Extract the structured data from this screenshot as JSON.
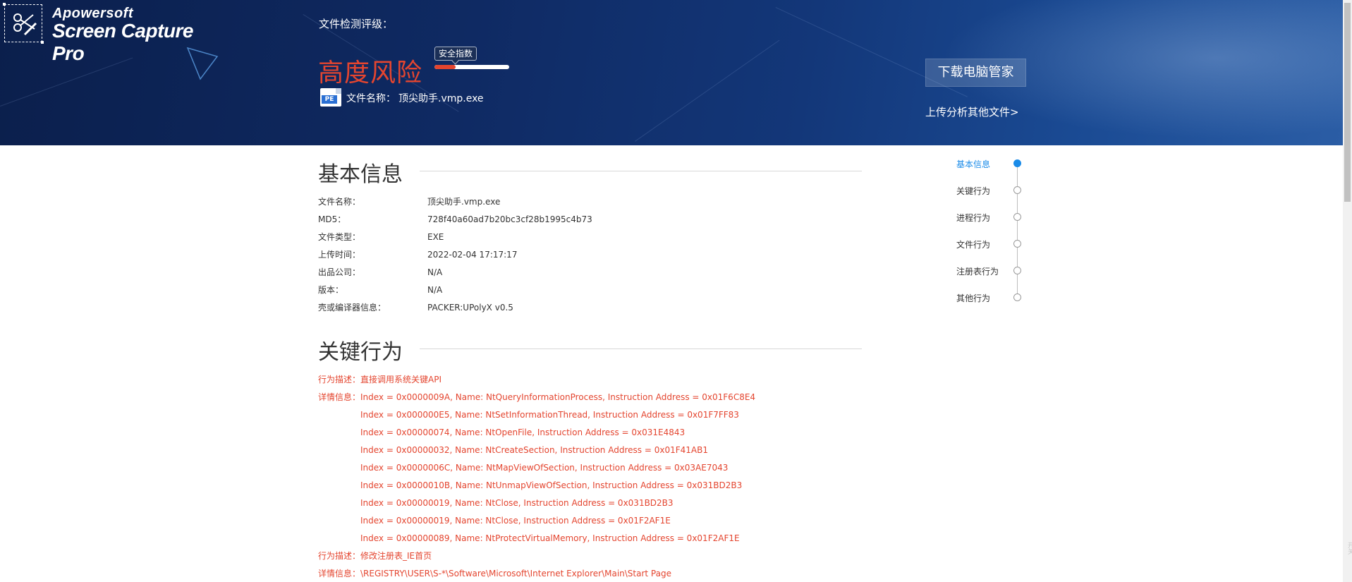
{
  "logo": {
    "brand": "Apowersoft",
    "product": "Screen Capture Pro"
  },
  "header": {
    "rating_label": "文件检测评级：",
    "risk_level": "高度风险",
    "safety_tip": "安全指数",
    "safety_score_fraction": 0.28,
    "file_label": "文件名称：",
    "file_name": "顶尖助手.vmp.exe",
    "file_icon_text": "PE",
    "download_button": "下载电脑管家",
    "upload_link": "上传分析其他文件>"
  },
  "basic_info": {
    "title": "基本信息",
    "rows": [
      {
        "label": "文件名称：",
        "value": "顶尖助手.vmp.exe"
      },
      {
        "label": "MD5：",
        "value": "728f40a60ad7b20bc3cf28b1995c4b73"
      },
      {
        "label": "文件类型：",
        "value": "EXE"
      },
      {
        "label": "上传时间：",
        "value": "2022-02-04 17:17:17"
      },
      {
        "label": "出品公司：",
        "value": "N/A"
      },
      {
        "label": "版本：",
        "value": "N/A"
      },
      {
        "label": "壳或编译器信息：",
        "value": "PACKER:UPolyX v0.5"
      }
    ]
  },
  "key_behavior": {
    "title": "关键行为",
    "desc_label": "行为描述：",
    "detail_label": "详情信息：",
    "group1_desc": "直接调用系统关键API",
    "group1_details": [
      "Index = 0x0000009A, Name: NtQueryInformationProcess, Instruction Address = 0x01F6C8E4",
      "Index = 0x000000E5, Name: NtSetInformationThread, Instruction Address = 0x01F7FF83",
      "Index = 0x00000074, Name: NtOpenFile, Instruction Address = 0x031E4843",
      "Index = 0x00000032, Name: NtCreateSection, Instruction Address = 0x01F41AB1",
      "Index = 0x0000006C, Name: NtMapViewOfSection, Instruction Address = 0x03AE7043",
      "Index = 0x0000010B, Name: NtUnmapViewOfSection, Instruction Address = 0x031BD2B3",
      "Index = 0x00000019, Name: NtClose, Instruction Address = 0x031BD2B3",
      "Index = 0x00000019, Name: NtClose, Instruction Address = 0x01F2AF1E",
      "Index = 0x00000089, Name: NtProtectVirtualMemory, Instruction Address = 0x01F2AF1E"
    ],
    "group2_desc": "修改注册表_IE首页",
    "group2_detail": "\\REGISTRY\\USER\\S-*\\Software\\Microsoft\\Internet Explorer\\Main\\Start Page"
  },
  "nav": {
    "items": [
      "基本信息",
      "关键行为",
      "进程行为",
      "文件行为",
      "注册表行为",
      "其他行为"
    ],
    "active_index": 0
  },
  "side_text": "开关",
  "colors": {
    "risk_red": "#e4452f",
    "active_blue": "#1a8be8",
    "banner_dark": "#0f2a63"
  }
}
